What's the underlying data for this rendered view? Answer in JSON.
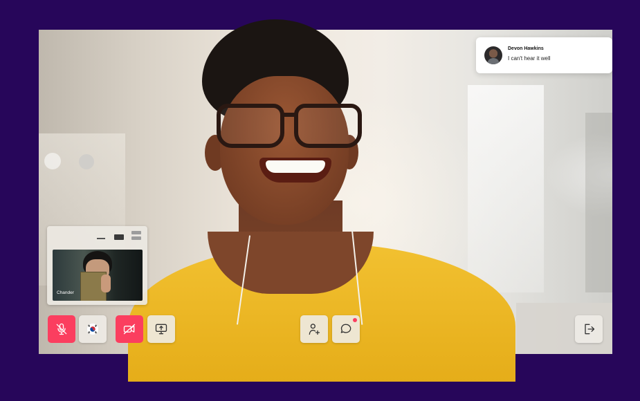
{
  "notification": {
    "sender": "Devon Hawkins",
    "message": "I can't hear it well"
  },
  "self_view": {
    "name": "Chander"
  },
  "controls": {
    "mic": {
      "state": "muted",
      "icon": "mic-off-icon"
    },
    "language": {
      "icon": "korea-flag-icon"
    },
    "camera": {
      "state": "off",
      "icon": "video-off-icon"
    },
    "share_screen": {
      "icon": "screen-share-icon"
    },
    "add_participant": {
      "icon": "add-user-icon"
    },
    "chat": {
      "icon": "chat-icon",
      "unread": true
    },
    "leave": {
      "icon": "leave-icon"
    }
  },
  "colors": {
    "background": "#27065a",
    "danger": "#fb3e5f",
    "button_light": "#eeebe6",
    "shirt": "#f2c131"
  }
}
